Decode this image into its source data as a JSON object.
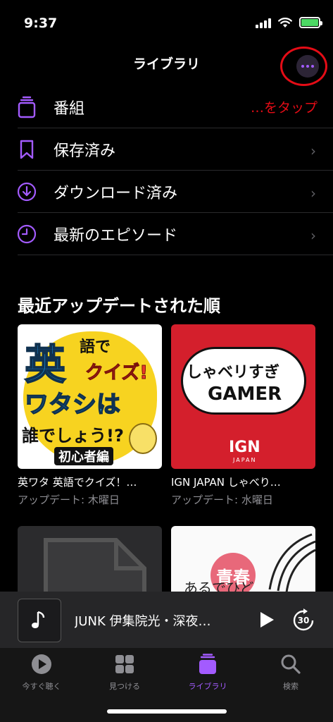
{
  "status_bar": {
    "time": "9:37"
  },
  "nav": {
    "title": "ライブラリ"
  },
  "annotation": {
    "tap_note": "…をタップ"
  },
  "library_items": [
    {
      "label": "番組",
      "icon": "stack-icon"
    },
    {
      "label": "保存済み",
      "icon": "bookmark-icon"
    },
    {
      "label": "ダウンロード済み",
      "icon": "download-circle-icon"
    },
    {
      "label": "最新のエピソード",
      "icon": "clock-icon"
    }
  ],
  "section": {
    "title": "最近アップデートされた順"
  },
  "shows": [
    {
      "title": "英ワタ 英語でクイズ！…",
      "updated": "アップデート: 木曜日",
      "art": {
        "line1": "英",
        "line2": "語で",
        "line3": "クイズ!",
        "line4": "ワタシは",
        "line5": "誰でしょう!?",
        "badge": "初心者編"
      }
    },
    {
      "title": "IGN JAPAN しゃべり…",
      "updated": "アップデート: 水曜日",
      "art": {
        "top": "しゃベリすぎ",
        "main": "GAMER",
        "logo": "IGN",
        "logo_sub": "JAPAN"
      }
    },
    {
      "title": "",
      "updated": "",
      "art": {}
    },
    {
      "title": "",
      "updated": "",
      "art": {
        "badge": "青春",
        "line1": "あるでひど"
      }
    }
  ],
  "player": {
    "title": "JUNK 伊集院光・深夜…",
    "skip_seconds": "30"
  },
  "tabs": [
    {
      "label": "今すぐ聴く",
      "icon": "play-circle-icon",
      "active": false
    },
    {
      "label": "見つける",
      "icon": "grid-icon",
      "active": false
    },
    {
      "label": "ライブラリ",
      "icon": "library-icon",
      "active": true
    },
    {
      "label": "検索",
      "icon": "search-icon",
      "active": false
    }
  ],
  "colors": {
    "accent": "#a35bff",
    "annotation_red": "#e40c16",
    "background": "#000000"
  }
}
